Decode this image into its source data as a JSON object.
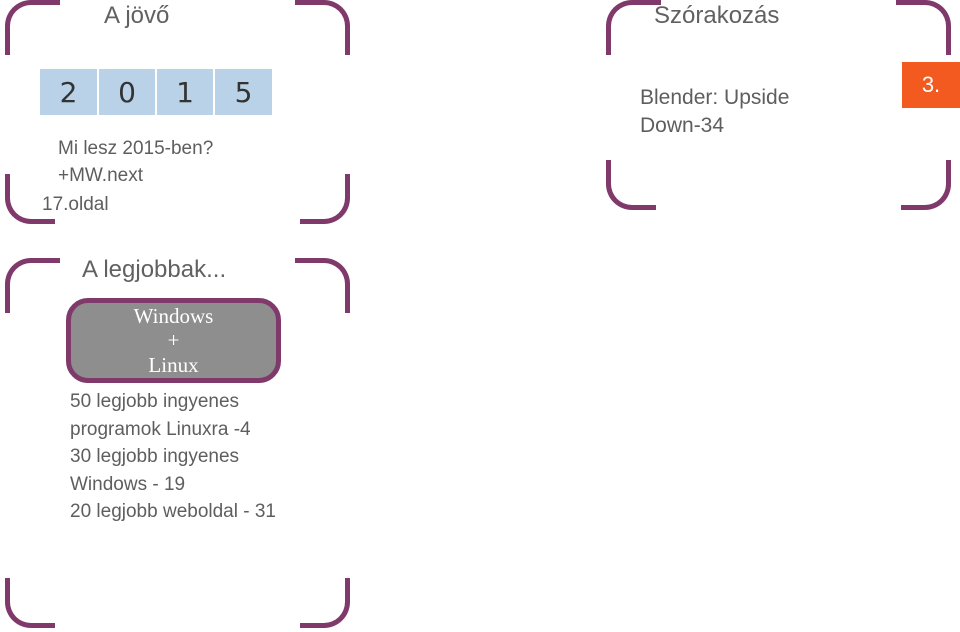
{
  "panel1": {
    "title": "A jövő",
    "date_digits": [
      "2",
      "0",
      "1",
      "5"
    ],
    "subline1": "Mi lesz 2015-ben?",
    "subline2": "+MW.next",
    "page_ref": "17.oldal"
  },
  "panel2": {
    "title": "Szórakozás",
    "body_line1": "Blender: Upside",
    "body_line2": "Down-34"
  },
  "panel3": {
    "title": "A legjobbak...",
    "badge_line1": "Windows",
    "badge_plus": "+",
    "badge_line2": "Linux",
    "body_l1": "50 legjobb ingyenes",
    "body_l2": "programok Linuxra -4",
    "body_l3": "30 legjobb ingyenes",
    "body_l4": "Windows - 19",
    "body_l5": "20 legjobb weboldal - 31"
  },
  "page_number_tab": "3."
}
